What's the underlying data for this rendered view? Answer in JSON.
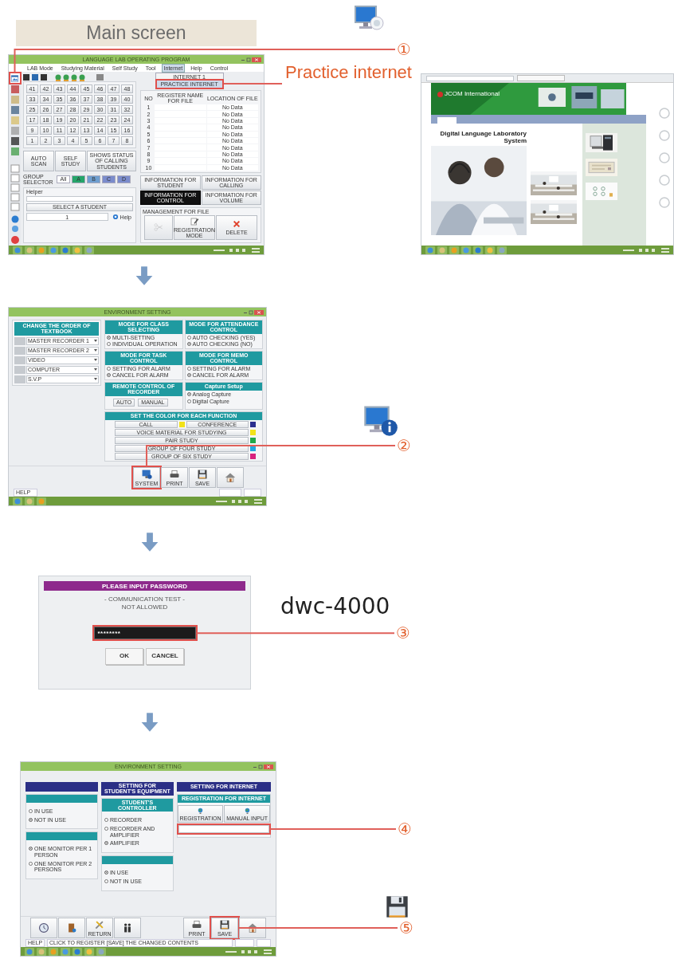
{
  "page_title": {
    "text": "Main screen"
  },
  "callouts": [
    {
      "number": "①"
    },
    {
      "number": "②"
    },
    {
      "number": "③"
    },
    {
      "number": "④"
    },
    {
      "number": "⑤"
    }
  ],
  "practice_label": "Practice internet",
  "password_hint": "dwc-4000",
  "main_window": {
    "title": "LANGUAGE LAB OPERATING PROGRAM",
    "internet_tool": {
      "highlighted": true
    },
    "menu": [
      {
        "label": "LAB Mode",
        "selected": false
      },
      {
        "label": "Studying Material",
        "selected": false
      },
      {
        "label": "Self Study",
        "selected": false
      },
      {
        "label": "Tool",
        "selected": false
      },
      {
        "label": "Internet",
        "selected": true,
        "dropdown": [
          {
            "label": "INTERNET 1",
            "selected": false
          },
          {
            "label": "PRACTICE INTERNET",
            "selected": true
          }
        ]
      },
      {
        "label": "Help",
        "selected": false
      },
      {
        "label": "Control",
        "selected": false
      }
    ],
    "seats": [
      "41",
      "42",
      "43",
      "44",
      "45",
      "46",
      "47",
      "48",
      "33",
      "34",
      "35",
      "36",
      "37",
      "38",
      "39",
      "40",
      "25",
      "26",
      "27",
      "28",
      "29",
      "30",
      "31",
      "32",
      "17",
      "18",
      "19",
      "20",
      "21",
      "22",
      "23",
      "24",
      "9",
      "10",
      "11",
      "12",
      "13",
      "14",
      "15",
      "16",
      "1",
      "2",
      "3",
      "4",
      "5",
      "6",
      "7",
      "8"
    ],
    "file_table": {
      "columns": [
        "NO",
        "REGISTER NAME FOR FILE",
        "LOCATION OF FILE"
      ],
      "rows": [
        {
          "no": "1",
          "location": "No Data"
        },
        {
          "no": "2",
          "location": "No Data"
        },
        {
          "no": "3",
          "location": "No Data"
        },
        {
          "no": "4",
          "location": "No Data"
        },
        {
          "no": "5",
          "location": "No Data"
        },
        {
          "no": "6",
          "location": "No Data"
        },
        {
          "no": "7",
          "location": "No Data"
        },
        {
          "no": "8",
          "location": "No Data"
        },
        {
          "no": "9",
          "location": "No Data"
        },
        {
          "no": "10",
          "location": "No Data"
        }
      ]
    },
    "actions": [
      "AUTO SCAN",
      "SELF STUDY",
      "SHOWS STATUS OF CALLING STUDENTS"
    ],
    "group_selector": {
      "label": "GROUP SELECTOR",
      "groups": [
        {
          "label": "All",
          "color": "#ffffff"
        },
        {
          "label": "A",
          "color": "#25a56a"
        },
        {
          "label": "B",
          "color": "#6f9fd0"
        },
        {
          "label": "C",
          "color": "#7b8ccc"
        },
        {
          "label": "D",
          "color": "#7b8ccc"
        }
      ]
    },
    "info_tabs": [
      {
        "label": "INFORMATION FOR STUDENT",
        "selected": false
      },
      {
        "label": "INFORMATION FOR CALLING",
        "selected": false
      },
      {
        "label": "INFORMATION FOR CONTROL",
        "selected": true
      },
      {
        "label": "INFORMATION FOR VOLUME",
        "selected": false
      }
    ],
    "helper": {
      "title": "Helper",
      "button": "SELECT A STUDENT",
      "value": "1",
      "help": "Help"
    },
    "file_management": {
      "title": "MANAGEMENT FOR FILE",
      "buttons": [
        {
          "kind": "scissors",
          "disabled": true
        },
        {
          "kind": "edit",
          "label": "REGISTRATION MODE",
          "disabled": false
        },
        {
          "kind": "delete",
          "label": "DELETE",
          "disabled": false
        }
      ]
    }
  },
  "browser": {
    "brand": "JCOM International",
    "heading": "Digital Language Laboratory System"
  },
  "settings_window": {
    "title": "ENVIRONMENT SETTING",
    "textbook": {
      "title": "CHANGE THE ORDER OF TEXTBOOK",
      "items": [
        "MASTER RECORDER 1",
        "MASTER RECORDER 2",
        "VIDEO",
        "COMPUTER",
        "S.V.P"
      ]
    },
    "modes": [
      {
        "title": "MODE FOR CLASS SELECTING",
        "options": [
          {
            "label": "MULTI-SETTING",
            "selected": true
          },
          {
            "label": "INDIVIDUAL OPERATION",
            "selected": false
          }
        ]
      },
      {
        "title": "MODE FOR ATTENDANCE CONTROL",
        "options": [
          {
            "label": "AUTO CHECKING (YES)",
            "selected": false
          },
          {
            "label": "AUTO CHECKING (NO)",
            "selected": true
          }
        ]
      },
      {
        "title": "MODE FOR TASK CONTROL",
        "options": [
          {
            "label": "SETTING FOR ALARM",
            "selected": false
          },
          {
            "label": "CANCEL FOR ALARM",
            "selected": true
          }
        ]
      },
      {
        "title": "MODE FOR MEMO CONTROL",
        "options": [
          {
            "label": "SETTING FOR ALARM",
            "selected": false
          },
          {
            "label": "CANCEL FOR ALARM",
            "selected": true
          }
        ]
      }
    ],
    "remote": {
      "title": "REMOTE CONTROL OF RECORDER",
      "buttons": [
        "AUTO",
        "MANUAL"
      ]
    },
    "capture": {
      "title": "Capture Setup",
      "options": [
        {
          "label": "Analog Capture",
          "selected": true
        },
        {
          "label": "Digital Capture",
          "selected": false
        }
      ]
    },
    "colors": {
      "title": "SET THE COLOR FOR EACH FUNCTION",
      "items": [
        {
          "label": "CALL",
          "color": "#f2e21a"
        },
        {
          "label": "CONFERENCE",
          "color": "#2b2f8f"
        },
        {
          "label": "VOICE MATERIAL FOR STUDYING",
          "color": "#f2e21a"
        },
        {
          "label": "PAIR STUDY",
          "color": "#22a84a"
        },
        {
          "label": "GROUP OF FOUR STUDY",
          "color": "#22a8e0"
        },
        {
          "label": "GROUP OF SIX STUDY",
          "color": "#d8237f"
        }
      ]
    },
    "toolbar": [
      {
        "kind": "system",
        "label": "SYSTEM",
        "highlighted": true
      },
      {
        "kind": "print",
        "label": "PRINT",
        "highlighted": false
      },
      {
        "kind": "save",
        "label": "SAVE",
        "highlighted": false
      },
      {
        "kind": "home",
        "highlighted": false
      }
    ],
    "status": "HELP"
  },
  "password_dialog": {
    "title": "PLEASE INPUT PASSWORD",
    "message": [
      "- COMMUNICATION TEST -",
      "NOT ALLOWED"
    ],
    "value": "********",
    "highlighted": true,
    "buttons": [
      "OK",
      "CANCEL"
    ]
  },
  "internet_window": {
    "title": "ENVIRONMENT SETTING",
    "columns": [
      {
        "sections": [
          {
            "options": [
              {
                "label": "IN USE",
                "selected": false
              },
              {
                "label": "NOT IN USE",
                "selected": true
              }
            ]
          },
          {
            "options": [
              {
                "label": "ONE MONITOR PER 1 PERSON",
                "selected": true
              },
              {
                "label": "ONE MONITOR PER 2 PERSONS",
                "selected": false
              }
            ]
          }
        ]
      },
      {
        "title": "SETTING FOR STUDENT'S EQUIPMENT",
        "sections": [
          {
            "title": "STUDENT'S CONTROLLER",
            "options": [
              {
                "label": "RECORDER",
                "selected": false
              },
              {
                "label": "RECORDER AND AMPLIFIER",
                "selected": false
              },
              {
                "label": "AMPLIFIER",
                "selected": true
              }
            ]
          },
          {
            "options": [
              {
                "label": "IN USE",
                "selected": true
              },
              {
                "label": "NOT IN USE",
                "selected": false
              }
            ]
          }
        ]
      },
      {
        "title": "SETTING FOR INTERNET",
        "sections": [
          {
            "title": "REGISTRATION FOR INTERNET",
            "buttons": [
              "REGISTRATION",
              "MANUAL INPUT"
            ],
            "field": {
              "highlighted": true
            }
          }
        ]
      }
    ],
    "tools_left": [
      {
        "kind": "clock",
        "highlighted": false
      },
      {
        "kind": "book",
        "highlighted": false
      },
      {
        "kind": "tools",
        "label": "RETURN",
        "highlighted": false
      },
      {
        "kind": "people",
        "highlighted": false
      }
    ],
    "tools_right": [
      {
        "kind": "print",
        "label": "PRINT",
        "highlighted": false
      },
      {
        "kind": "save",
        "label": "SAVE",
        "highlighted": true
      },
      {
        "kind": "home",
        "highlighted": false
      }
    ],
    "status": [
      "HELP",
      "CLICK TO REGISTER [SAVE] THE CHANGED CONTENTS"
    ]
  }
}
